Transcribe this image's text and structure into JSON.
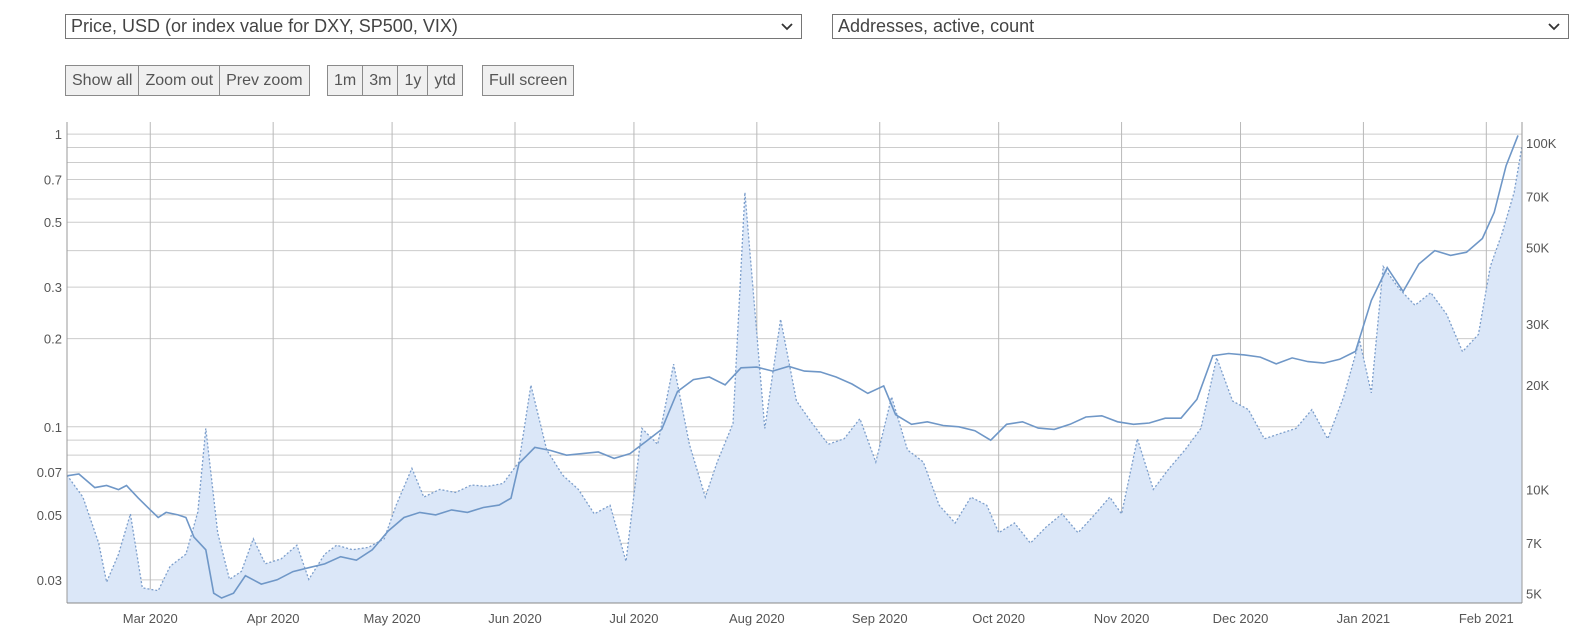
{
  "controls": {
    "left_select": "Price, USD (or index value for DXY, SP500, VIX)",
    "right_select": "Addresses, active, count",
    "zoom_buttons": [
      "Show all",
      "Zoom out",
      "Prev zoom"
    ],
    "range_buttons": [
      "1m",
      "3m",
      "1y",
      "ytd"
    ],
    "fullscreen_button": "Full screen",
    "icons": {
      "dropdown": "chevron-down-icon"
    }
  },
  "chart_data": {
    "type": "line",
    "grid": true,
    "colors": {
      "price_line": "#6f97c7",
      "addresses_area": "#dbe7f8",
      "addresses_line": "#7d9fcc",
      "grid": "#cccccc"
    },
    "x_axis": {
      "range": [
        "2020-02-09",
        "2021-02-10"
      ],
      "ticks": [
        {
          "date": "2020-03-01",
          "label": "Mar 2020"
        },
        {
          "date": "2020-04-01",
          "label": "Apr 2020"
        },
        {
          "date": "2020-05-01",
          "label": "May 2020"
        },
        {
          "date": "2020-06-01",
          "label": "Jun 2020"
        },
        {
          "date": "2020-07-01",
          "label": "Jul 2020"
        },
        {
          "date": "2020-08-01",
          "label": "Aug 2020"
        },
        {
          "date": "2020-09-01",
          "label": "Sep 2020"
        },
        {
          "date": "2020-10-01",
          "label": "Oct 2020"
        },
        {
          "date": "2020-11-01",
          "label": "Nov 2020"
        },
        {
          "date": "2020-12-01",
          "label": "Dec 2020"
        },
        {
          "date": "2021-01-01",
          "label": "Jan 2021"
        },
        {
          "date": "2021-02-01",
          "label": "Feb 2021"
        }
      ]
    },
    "y_left": {
      "scale": "log",
      "range": [
        0.025,
        1.1
      ],
      "ticks": [
        {
          "value": 1,
          "label": "1"
        },
        {
          "value": 0.7,
          "label": "0.7"
        },
        {
          "value": 0.5,
          "label": "0.5"
        },
        {
          "value": 0.3,
          "label": "0.3"
        },
        {
          "value": 0.2,
          "label": "0.2"
        },
        {
          "value": 0.1,
          "label": "0.1"
        },
        {
          "value": 0.07,
          "label": "0.07"
        },
        {
          "value": 0.05,
          "label": "0.05"
        },
        {
          "value": 0.03,
          "label": "0.03"
        }
      ]
    },
    "y_right": {
      "scale": "log",
      "range": [
        4700,
        115000
      ],
      "ticks": [
        {
          "value": 100000,
          "label": "100K"
        },
        {
          "value": 70000,
          "label": "70K"
        },
        {
          "value": 50000,
          "label": "50K"
        },
        {
          "value": 30000,
          "label": "30K"
        },
        {
          "value": 20000,
          "label": "20K"
        },
        {
          "value": 10000,
          "label": "10K"
        },
        {
          "value": 7000,
          "label": "7K"
        },
        {
          "value": 5000,
          "label": "5K"
        }
      ]
    },
    "series": [
      {
        "axis": "left",
        "style": "solid-line",
        "points": [
          [
            "2020-02-09",
            0.068
          ],
          [
            "2020-02-12",
            0.069
          ],
          [
            "2020-02-16",
            0.062
          ],
          [
            "2020-02-19",
            0.063
          ],
          [
            "2020-02-22",
            0.061
          ],
          [
            "2020-02-24",
            0.063
          ],
          [
            "2020-02-27",
            0.057
          ],
          [
            "2020-03-01",
            0.052
          ],
          [
            "2020-03-03",
            0.049
          ],
          [
            "2020-03-05",
            0.051
          ],
          [
            "2020-03-08",
            0.05
          ],
          [
            "2020-03-10",
            0.049
          ],
          [
            "2020-03-12",
            0.042
          ],
          [
            "2020-03-15",
            0.038
          ],
          [
            "2020-03-17",
            0.027
          ],
          [
            "2020-03-19",
            0.026
          ],
          [
            "2020-03-22",
            0.027
          ],
          [
            "2020-03-25",
            0.031
          ],
          [
            "2020-03-29",
            0.029
          ],
          [
            "2020-04-02",
            0.03
          ],
          [
            "2020-04-06",
            0.032
          ],
          [
            "2020-04-10",
            0.033
          ],
          [
            "2020-04-14",
            0.034
          ],
          [
            "2020-04-18",
            0.036
          ],
          [
            "2020-04-22",
            0.035
          ],
          [
            "2020-04-26",
            0.038
          ],
          [
            "2020-04-30",
            0.044
          ],
          [
            "2020-05-04",
            0.049
          ],
          [
            "2020-05-08",
            0.051
          ],
          [
            "2020-05-12",
            0.05
          ],
          [
            "2020-05-16",
            0.052
          ],
          [
            "2020-05-20",
            0.051
          ],
          [
            "2020-05-24",
            0.053
          ],
          [
            "2020-05-28",
            0.054
          ],
          [
            "2020-05-31",
            0.057
          ],
          [
            "2020-06-02",
            0.075
          ],
          [
            "2020-06-06",
            0.085
          ],
          [
            "2020-06-10",
            0.083
          ],
          [
            "2020-06-14",
            0.08
          ],
          [
            "2020-06-18",
            0.081
          ],
          [
            "2020-06-22",
            0.082
          ],
          [
            "2020-06-26",
            0.078
          ],
          [
            "2020-06-30",
            0.081
          ],
          [
            "2020-07-04",
            0.089
          ],
          [
            "2020-07-08",
            0.098
          ],
          [
            "2020-07-12",
            0.132
          ],
          [
            "2020-07-16",
            0.145
          ],
          [
            "2020-07-20",
            0.148
          ],
          [
            "2020-07-24",
            0.139
          ],
          [
            "2020-07-28",
            0.159
          ],
          [
            "2020-08-01",
            0.16
          ],
          [
            "2020-08-05",
            0.155
          ],
          [
            "2020-08-09",
            0.161
          ],
          [
            "2020-08-13",
            0.155
          ],
          [
            "2020-08-17",
            0.154
          ],
          [
            "2020-08-21",
            0.148
          ],
          [
            "2020-08-25",
            0.14
          ],
          [
            "2020-08-29",
            0.13
          ],
          [
            "2020-09-02",
            0.138
          ],
          [
            "2020-09-05",
            0.11
          ],
          [
            "2020-09-09",
            0.102
          ],
          [
            "2020-09-13",
            0.104
          ],
          [
            "2020-09-17",
            0.101
          ],
          [
            "2020-09-21",
            0.1
          ],
          [
            "2020-09-25",
            0.097
          ],
          [
            "2020-09-29",
            0.09
          ],
          [
            "2020-10-03",
            0.102
          ],
          [
            "2020-10-07",
            0.104
          ],
          [
            "2020-10-11",
            0.099
          ],
          [
            "2020-10-15",
            0.098
          ],
          [
            "2020-10-19",
            0.102
          ],
          [
            "2020-10-23",
            0.108
          ],
          [
            "2020-10-27",
            0.109
          ],
          [
            "2020-10-31",
            0.104
          ],
          [
            "2020-11-04",
            0.102
          ],
          [
            "2020-11-08",
            0.103
          ],
          [
            "2020-11-12",
            0.107
          ],
          [
            "2020-11-16",
            0.107
          ],
          [
            "2020-11-20",
            0.124
          ],
          [
            "2020-11-24",
            0.175
          ],
          [
            "2020-11-28",
            0.178
          ],
          [
            "2020-12-02",
            0.176
          ],
          [
            "2020-12-06",
            0.173
          ],
          [
            "2020-12-10",
            0.164
          ],
          [
            "2020-12-14",
            0.172
          ],
          [
            "2020-12-18",
            0.167
          ],
          [
            "2020-12-22",
            0.165
          ],
          [
            "2020-12-26",
            0.17
          ],
          [
            "2020-12-30",
            0.181
          ],
          [
            "2021-01-03",
            0.27
          ],
          [
            "2021-01-07",
            0.35
          ],
          [
            "2021-01-11",
            0.29
          ],
          [
            "2021-01-15",
            0.36
          ],
          [
            "2021-01-19",
            0.4
          ],
          [
            "2021-01-23",
            0.385
          ],
          [
            "2021-01-27",
            0.395
          ],
          [
            "2021-01-31",
            0.44
          ],
          [
            "2021-02-03",
            0.54
          ],
          [
            "2021-02-06",
            0.78
          ],
          [
            "2021-02-09",
            0.99
          ]
        ]
      },
      {
        "axis": "right",
        "style": "dotted-line-area",
        "points": [
          [
            "2020-02-09",
            11000
          ],
          [
            "2020-02-13",
            9500
          ],
          [
            "2020-02-17",
            7000
          ],
          [
            "2020-02-19",
            5400
          ],
          [
            "2020-02-22",
            6500
          ],
          [
            "2020-02-25",
            8500
          ],
          [
            "2020-02-28",
            5200
          ],
          [
            "2020-03-03",
            5100
          ],
          [
            "2020-03-06",
            6000
          ],
          [
            "2020-03-10",
            6500
          ],
          [
            "2020-03-13",
            8600
          ],
          [
            "2020-03-15",
            15000
          ],
          [
            "2020-03-18",
            7500
          ],
          [
            "2020-03-21",
            5500
          ],
          [
            "2020-03-24",
            5800
          ],
          [
            "2020-03-27",
            7200
          ],
          [
            "2020-03-30",
            6100
          ],
          [
            "2020-04-03",
            6300
          ],
          [
            "2020-04-07",
            6900
          ],
          [
            "2020-04-10",
            5500
          ],
          [
            "2020-04-14",
            6500
          ],
          [
            "2020-04-17",
            6900
          ],
          [
            "2020-04-21",
            6700
          ],
          [
            "2020-04-25",
            6800
          ],
          [
            "2020-04-29",
            7200
          ],
          [
            "2020-05-02",
            9000
          ],
          [
            "2020-05-06",
            11500
          ],
          [
            "2020-05-09",
            9500
          ],
          [
            "2020-05-13",
            10000
          ],
          [
            "2020-05-17",
            9800
          ],
          [
            "2020-05-21",
            10300
          ],
          [
            "2020-05-25",
            10200
          ],
          [
            "2020-05-29",
            10400
          ],
          [
            "2020-06-02",
            12000
          ],
          [
            "2020-06-05",
            20000
          ],
          [
            "2020-06-09",
            13000
          ],
          [
            "2020-06-13",
            11000
          ],
          [
            "2020-06-17",
            10000
          ],
          [
            "2020-06-21",
            8500
          ],
          [
            "2020-06-25",
            9000
          ],
          [
            "2020-06-29",
            6200
          ],
          [
            "2020-07-03",
            15000
          ],
          [
            "2020-07-07",
            13500
          ],
          [
            "2020-07-11",
            23000
          ],
          [
            "2020-07-15",
            13500
          ],
          [
            "2020-07-19",
            9500
          ],
          [
            "2020-07-22",
            12000
          ],
          [
            "2020-07-26",
            15500
          ],
          [
            "2020-07-29",
            72000
          ],
          [
            "2020-08-03",
            15000
          ],
          [
            "2020-08-07",
            31000
          ],
          [
            "2020-08-11",
            18000
          ],
          [
            "2020-08-15",
            15500
          ],
          [
            "2020-08-19",
            13500
          ],
          [
            "2020-08-23",
            14000
          ],
          [
            "2020-08-27",
            16000
          ],
          [
            "2020-08-31",
            12000
          ],
          [
            "2020-09-04",
            18500
          ],
          [
            "2020-09-08",
            13000
          ],
          [
            "2020-09-12",
            12000
          ],
          [
            "2020-09-16",
            9000
          ],
          [
            "2020-09-20",
            8000
          ],
          [
            "2020-09-24",
            9500
          ],
          [
            "2020-09-28",
            9000
          ],
          [
            "2020-10-01",
            7500
          ],
          [
            "2020-10-05",
            8000
          ],
          [
            "2020-10-09",
            7000
          ],
          [
            "2020-10-13",
            7800
          ],
          [
            "2020-10-17",
            8500
          ],
          [
            "2020-10-21",
            7500
          ],
          [
            "2020-10-25",
            8400
          ],
          [
            "2020-10-29",
            9500
          ],
          [
            "2020-11-01",
            8500
          ],
          [
            "2020-11-05",
            14000
          ],
          [
            "2020-11-09",
            10000
          ],
          [
            "2020-11-13",
            11500
          ],
          [
            "2020-11-17",
            13000
          ],
          [
            "2020-11-21",
            15000
          ],
          [
            "2020-11-25",
            24000
          ],
          [
            "2020-11-29",
            18000
          ],
          [
            "2020-12-03",
            17000
          ],
          [
            "2020-12-07",
            14000
          ],
          [
            "2020-12-11",
            14500
          ],
          [
            "2020-12-15",
            15000
          ],
          [
            "2020-12-19",
            17000
          ],
          [
            "2020-12-23",
            14000
          ],
          [
            "2020-12-27",
            18500
          ],
          [
            "2020-12-31",
            27000
          ],
          [
            "2021-01-03",
            19000
          ],
          [
            "2021-01-06",
            44000
          ],
          [
            "2021-01-10",
            38000
          ],
          [
            "2021-01-14",
            34000
          ],
          [
            "2021-01-18",
            37000
          ],
          [
            "2021-01-22",
            32000
          ],
          [
            "2021-01-26",
            25000
          ],
          [
            "2021-01-30",
            28000
          ],
          [
            "2021-02-02",
            44000
          ],
          [
            "2021-02-05",
            55000
          ],
          [
            "2021-02-08",
            72000
          ],
          [
            "2021-02-10",
            98000
          ]
        ]
      }
    ]
  }
}
